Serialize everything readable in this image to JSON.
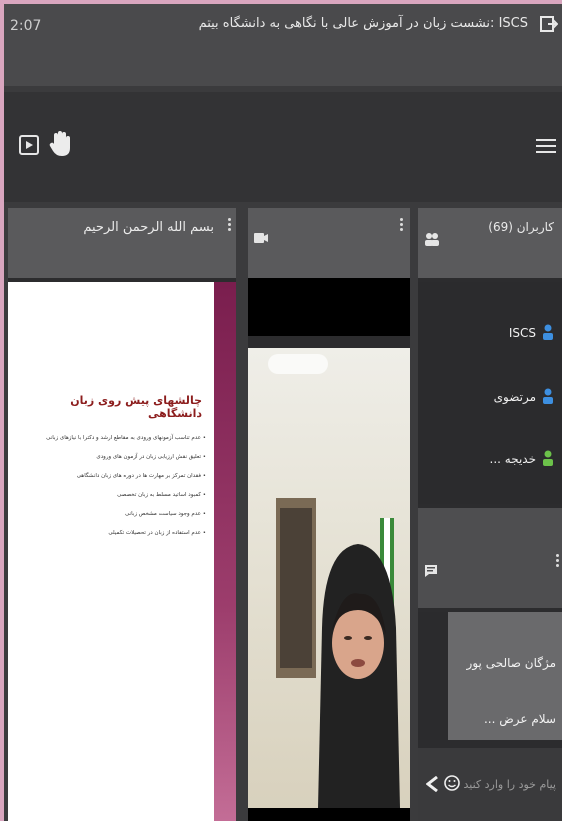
{
  "titlebar": {
    "time": "2:07",
    "title": "ISCS :نشست زبان در آموزش عالی با نگاهی به دانشگاه بیتم"
  },
  "toolbar": {
    "icons": [
      "screen-share-icon",
      "hand-icon",
      "menu-icon"
    ]
  },
  "slide_panel": {
    "title": "بسم الله الرحمن الرحیم",
    "slide": {
      "heading": "چالشهای پیش روی زبان دانشگاهی",
      "bullets": [
        "• عدم تناسب آزمونهای ورودی به مقاطع ارشد و دکترا با نیازهای زبانی",
        "• تعلیق نقش ارزیابی زبان در آزمون های ورودی",
        "• فقدان تمرکز بر مهارت ها در دوره های زبان دانشگاهی",
        "• کمبود اساتید مسلط به زبان تخصصی",
        "• عدم وجود سیاست مشخص زبانی",
        "• عدم استفاده از زبان در تحصیلات تکمیلی"
      ]
    }
  },
  "video_panel": {},
  "participants": {
    "title": "کاربران (69)",
    "items": [
      {
        "name": "ISCS",
        "color": "#3d8fe0"
      },
      {
        "name": "مرتضوی",
        "color": "#3d8fe0"
      },
      {
        "name": "خدیجه ...",
        "color": "#6cc24a"
      }
    ]
  },
  "chat": {
    "sender": "مژگان صالحی پور",
    "message": "سلام عرض ...",
    "input_placeholder": "پیام خود را وارد کنید"
  }
}
